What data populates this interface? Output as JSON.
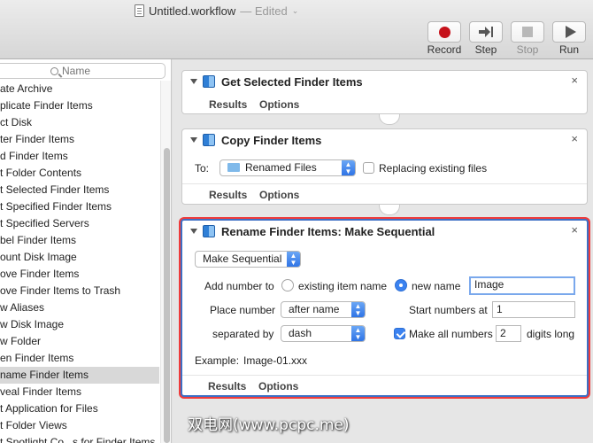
{
  "window": {
    "title": "Untitled.workflow",
    "edited": "— Edited"
  },
  "toolbar": {
    "record": "Record",
    "step": "Step",
    "stop": "Stop",
    "run": "Run",
    "record_color": "#c6121b"
  },
  "sidebar": {
    "search_placeholder": "Name",
    "items": [
      "ate Archive",
      "plicate Finder Items",
      "ct Disk",
      "ter Finder Items",
      "d Finder Items",
      "t Folder Contents",
      "t Selected Finder Items",
      "t Specified Finder Items",
      "t Specified Servers",
      "bel Finder Items",
      "ount Disk Image",
      "ove Finder Items",
      "ove Finder Items to Trash",
      "w Aliases",
      "w Disk Image",
      "w Folder",
      "en Finder Items",
      "name Finder Items",
      "veal Finder Items",
      "t Application for Files",
      "t Folder Views",
      "t Spotlight Co...s for Finder Items"
    ],
    "selected_index": 17
  },
  "actions": {
    "get_selected": {
      "title": "Get Selected Finder Items",
      "results": "Results",
      "options": "Options"
    },
    "copy": {
      "title": "Copy Finder Items",
      "to_label": "To:",
      "to_value": "Renamed Files",
      "replacing_label": "Replacing existing files",
      "results": "Results",
      "options": "Options"
    },
    "rename": {
      "title": "Rename Finder Items: Make Sequential",
      "mode": "Make Sequential",
      "add_number_to": "Add number to",
      "existing_item_name": "existing item name",
      "new_name": "new name",
      "new_name_value": "Image",
      "place_number": "Place number",
      "place_number_value": "after name",
      "start_numbers_at": "Start numbers at",
      "start_value": "1",
      "separated_by": "separated by",
      "separator_value": "dash",
      "make_all_numbers": "Make all numbers",
      "digits_value": "2",
      "digits_long": "digits long",
      "example_label": "Example:",
      "example_value": "Image-01.xxx",
      "results": "Results",
      "options": "Options"
    }
  },
  "close_glyph": "×",
  "watermark": "双电网(www.pcpc.me)",
  "accent_color": "#3b82f0",
  "highlight_color": "#ef3b3b"
}
